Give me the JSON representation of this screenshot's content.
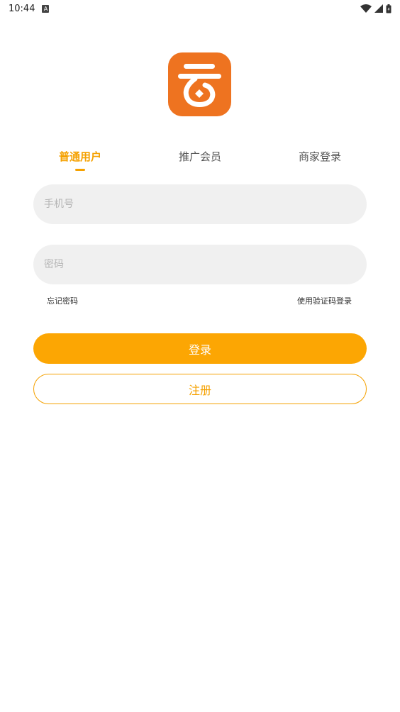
{
  "status_bar": {
    "time": "10:44",
    "notification_icon": "a-letter-icon",
    "icons": [
      "wifi-icon",
      "signal-icon",
      "battery-icon"
    ]
  },
  "logo": {
    "icon": "cloud-coin-logo-icon",
    "color": "#ee7320"
  },
  "tabs": [
    {
      "label": "普通用户",
      "active": true
    },
    {
      "label": "推广会员",
      "active": false
    },
    {
      "label": "商家登录",
      "active": false
    }
  ],
  "form": {
    "phone_placeholder": "手机号",
    "password_placeholder": "密码",
    "forgot_password": "忘记密码",
    "sms_login": "使用验证码登录",
    "login_button": "登录",
    "register_button": "注册"
  },
  "colors": {
    "accent": "#f5a100",
    "login_button": "#fca603",
    "input_bg": "#f0f0f0"
  }
}
